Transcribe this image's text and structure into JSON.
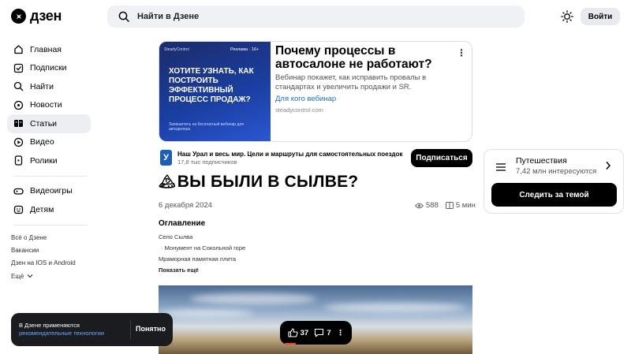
{
  "header": {
    "logo_text": "дзен",
    "search_placeholder": "Найти в Дзене",
    "login_label": "Войти"
  },
  "sidebar": {
    "items": [
      {
        "label": "Главная",
        "icon": "home-icon"
      },
      {
        "label": "Подписки",
        "icon": "subscriptions-icon"
      },
      {
        "label": "Найти",
        "icon": "search-icon"
      },
      {
        "label": "Новости",
        "icon": "news-icon"
      },
      {
        "label": "Статьи",
        "icon": "articles-icon",
        "active": true
      },
      {
        "label": "Видео",
        "icon": "video-icon"
      },
      {
        "label": "Ролики",
        "icon": "shorts-icon"
      }
    ],
    "extra": [
      {
        "label": "Видеоигры",
        "icon": "gamepad-icon"
      },
      {
        "label": "Детям",
        "icon": "kids-icon"
      }
    ],
    "footer_links": [
      "Всё о Дзене",
      "Вакансии",
      "Дзен на IOS и Android",
      "Ещё"
    ]
  },
  "ad": {
    "image_brand": "SteadyControl",
    "image_label": "Реклама · 16+",
    "image_headline": "Хотите узнать, как построить эффективный процесс продаж?",
    "image_sub": "Запишитесь на бесплатный вебинар для автодилера",
    "title": "Почему процессы в автосалоне не работают?",
    "description": "Вебинар покажет, как исправить провалы в стандартах и увеличить продажи и SR.",
    "link": "Для кого вебинар",
    "domain": "steadycontrol.com"
  },
  "channel": {
    "avatar_letter": "У",
    "name": "Наш Урал и весь мир. Цели и маршруты для самостоятельных поездок",
    "subscribers": "17,8 тыс подписчиков",
    "subscribe_label": "Подписаться"
  },
  "article": {
    "emoji": "🏔",
    "title": "ВЫ БЫЛИ В СЫЛВЕ?",
    "date": "6 декабря 2024",
    "views": "588",
    "read_time": "5 мин",
    "toc_title": "Оглавление",
    "toc": [
      {
        "label": "Село Сылва",
        "sub": false
      },
      {
        "label": "· Монумент на Сокольной горе",
        "sub": true
      },
      {
        "label": "Мраморная памятная плита",
        "sub": false
      }
    ],
    "toc_more": "Показать ещё",
    "likes": "37",
    "comments": "7"
  },
  "topic": {
    "name": "Путешествия",
    "count": "7,42 млн интересуются",
    "follow_label": "Следить за темой"
  },
  "toast": {
    "text": "В Дзене применяются",
    "link": "рекомендательные технологии",
    "button": "Понятно"
  }
}
